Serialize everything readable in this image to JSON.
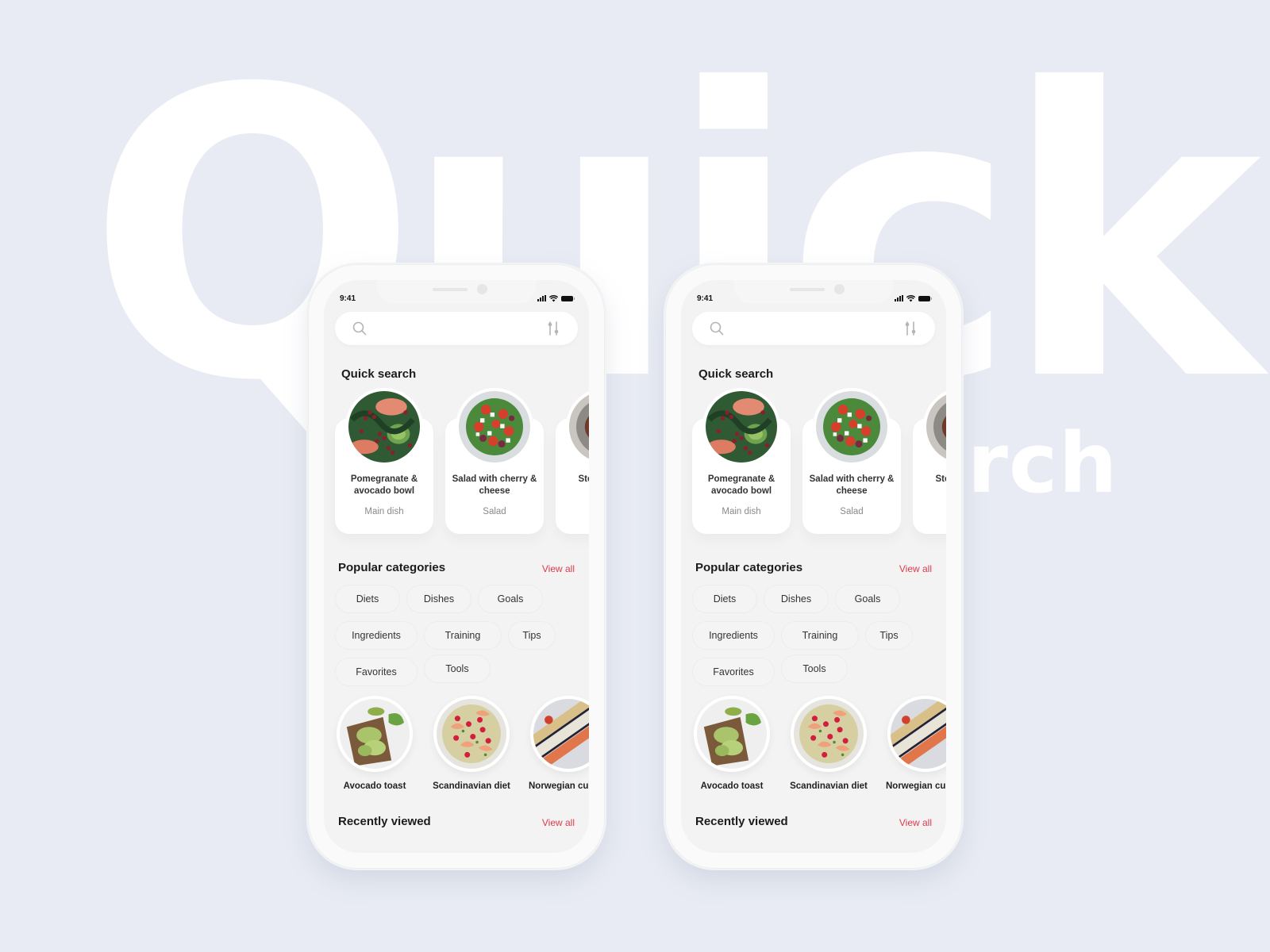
{
  "background": {
    "headline_word_1": "Quick",
    "headline_word_2": "Search",
    "color": "#e8ebf3"
  },
  "accent_color": "#e0394a",
  "phones": [
    {
      "status_bar": {
        "time": "9:41",
        "icons": [
          "signal-icon",
          "wifi-icon",
          "battery-icon"
        ]
      },
      "search": {
        "placeholder": "",
        "value": "",
        "icon": "search-icon",
        "filter_icon": "filter-icon"
      },
      "quick_search": {
        "title": "Quick search",
        "cards": [
          {
            "title": "Pomegranate & avocado bowl",
            "subtitle": "Main dish",
            "image": "pomegranate-avocado-bowl"
          },
          {
            "title": "Salad with cherry & cheese",
            "subtitle": "Salad",
            "image": "cherry-cheese-salad"
          },
          {
            "title": "Steak and ...",
            "subtitle": "",
            "image": "steak-dish"
          }
        ]
      },
      "popular_categories": {
        "title": "Popular categories",
        "view_all": "View all",
        "chips": [
          [
            "Diets",
            "Dishes",
            "Goals"
          ],
          [
            "Ingredients",
            "Training",
            "Tips"
          ],
          [
            "Favorites",
            "Tools"
          ]
        ]
      },
      "dishes": [
        {
          "label": "Avocado toast",
          "image": "avocado-toast"
        },
        {
          "label": "Scandinavian diet",
          "image": "scandinavian-diet"
        },
        {
          "label": "Norwegian cuisine",
          "image": "norwegian-dish"
        }
      ],
      "recently_viewed": {
        "title": "Recently viewed",
        "view_all": "View all"
      }
    },
    {
      "status_bar": {
        "time": "9:41",
        "icons": [
          "signal-icon",
          "wifi-icon",
          "battery-icon"
        ]
      },
      "search": {
        "placeholder": "",
        "value": "",
        "icon": "search-icon",
        "filter_icon": "filter-icon"
      },
      "quick_search": {
        "title": "Quick search",
        "cards": [
          {
            "title": "Pomegranate & avocado bowl",
            "subtitle": "Main dish",
            "image": "pomegranate-avocado-bowl"
          },
          {
            "title": "Salad with cherry & cheese",
            "subtitle": "Salad",
            "image": "cherry-cheese-salad"
          },
          {
            "title": "Steak and ...",
            "subtitle": "",
            "image": "steak-dish"
          }
        ]
      },
      "popular_categories": {
        "title": "Popular categories",
        "view_all": "View all",
        "chips": [
          [
            "Diets",
            "Dishes",
            "Goals"
          ],
          [
            "Ingredients",
            "Training",
            "Tips"
          ],
          [
            "Favorites",
            "Tools"
          ]
        ]
      },
      "dishes": [
        {
          "label": "Avocado toast",
          "image": "avocado-toast"
        },
        {
          "label": "Scandinavian diet",
          "image": "scandinavian-diet"
        },
        {
          "label": "Norwegian cuisine",
          "image": "norwegian-dish"
        }
      ],
      "recently_viewed": {
        "title": "Recently viewed",
        "view_all": "View all"
      }
    }
  ]
}
